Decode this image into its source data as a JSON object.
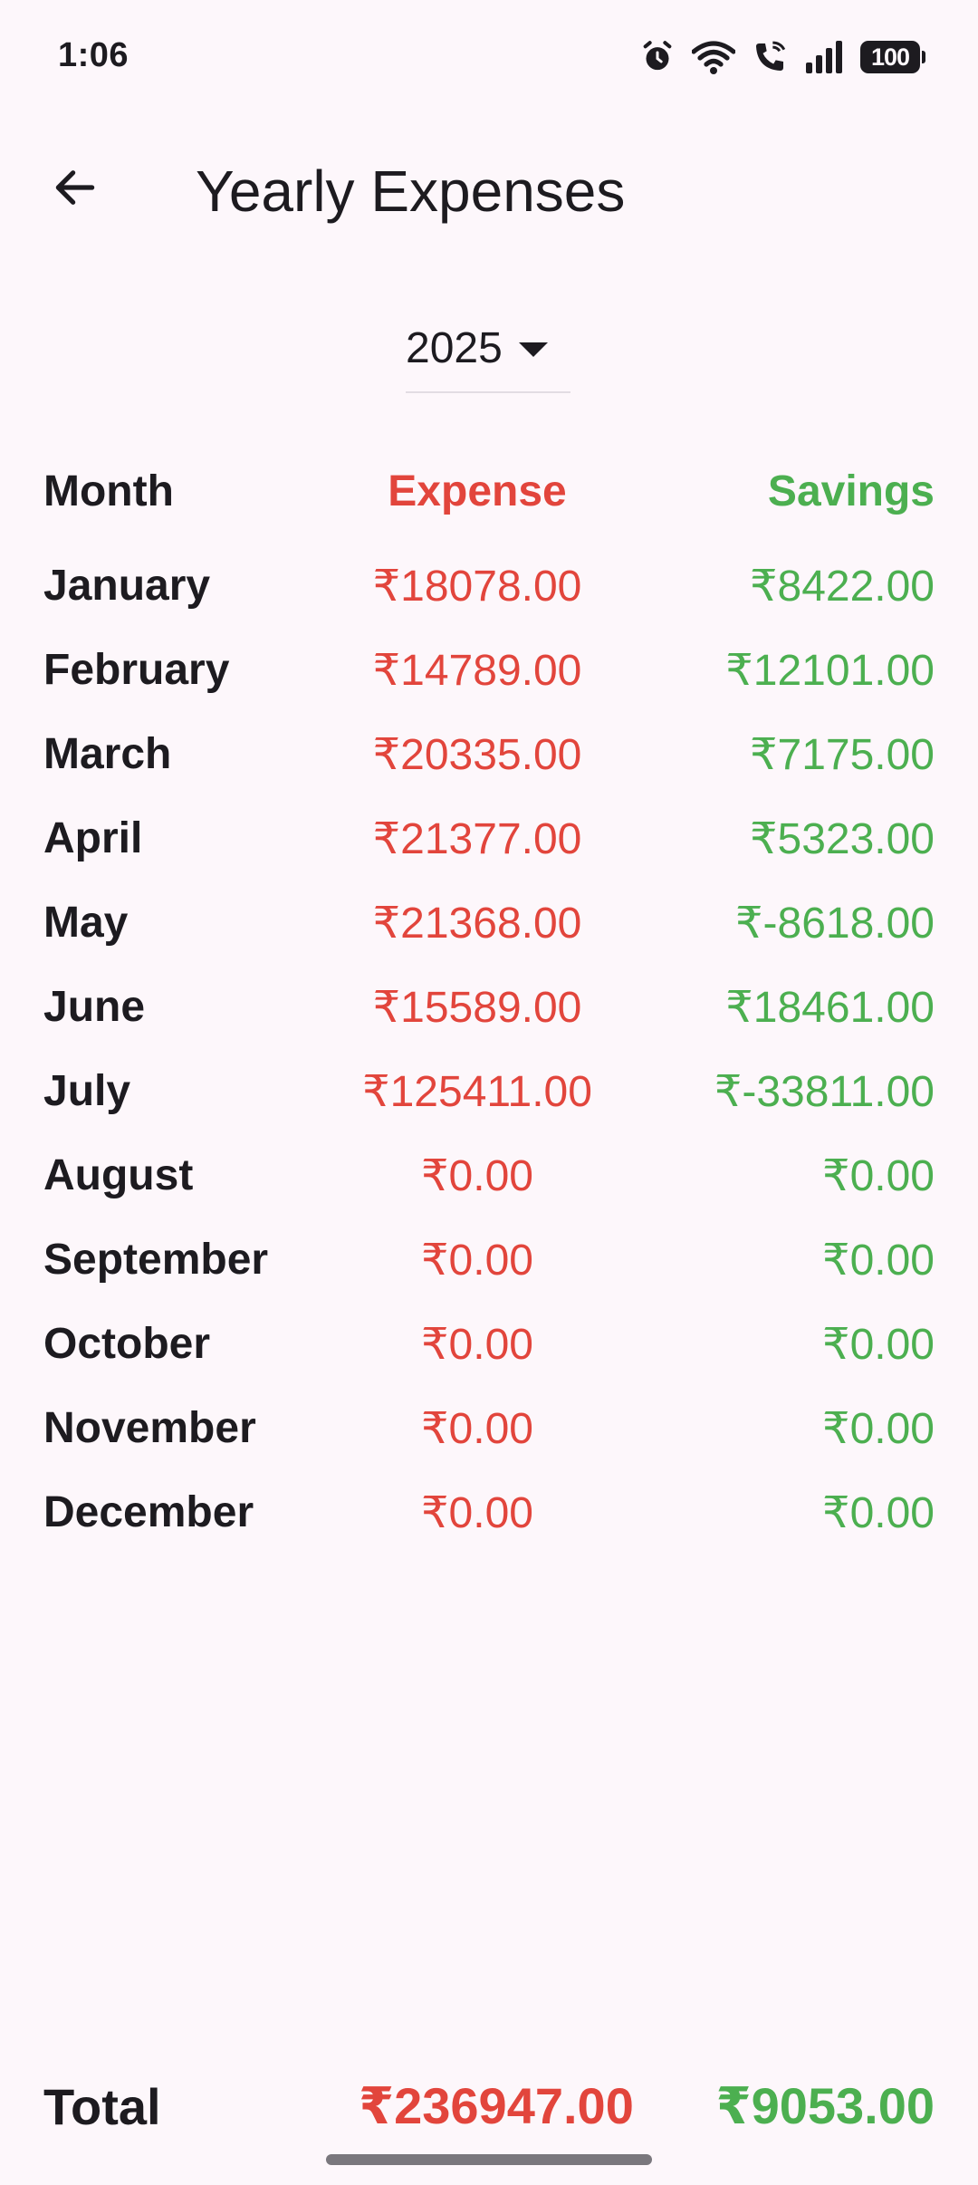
{
  "status_bar": {
    "time": "1:06",
    "battery": "100",
    "icons": [
      "alarm-icon",
      "wifi-icon",
      "wifi-calling-icon",
      "signal-icon",
      "battery-icon"
    ]
  },
  "app_bar": {
    "title": "Yearly Expenses",
    "back_icon": "arrow-back-icon"
  },
  "year_select": {
    "value": "2025"
  },
  "table": {
    "headers": {
      "month": "Month",
      "expense": "Expense",
      "savings": "Savings"
    },
    "rows": [
      {
        "month": "January",
        "expense": "₹18078.00",
        "savings": "₹8422.00"
      },
      {
        "month": "February",
        "expense": "₹14789.00",
        "savings": "₹12101.00"
      },
      {
        "month": "March",
        "expense": "₹20335.00",
        "savings": "₹7175.00"
      },
      {
        "month": "April",
        "expense": "₹21377.00",
        "savings": "₹5323.00"
      },
      {
        "month": "May",
        "expense": "₹21368.00",
        "savings": "₹-8618.00"
      },
      {
        "month": "June",
        "expense": "₹15589.00",
        "savings": "₹18461.00"
      },
      {
        "month": "July",
        "expense": "₹125411.00",
        "savings": "₹-33811.00"
      },
      {
        "month": "August",
        "expense": "₹0.00",
        "savings": "₹0.00"
      },
      {
        "month": "September",
        "expense": "₹0.00",
        "savings": "₹0.00"
      },
      {
        "month": "October",
        "expense": "₹0.00",
        "savings": "₹0.00"
      },
      {
        "month": "November",
        "expense": "₹0.00",
        "savings": "₹0.00"
      },
      {
        "month": "December",
        "expense": "₹0.00",
        "savings": "₹0.00"
      }
    ]
  },
  "total": {
    "label": "Total",
    "expense": "₹236947.00",
    "savings": "₹9053.00"
  },
  "colors": {
    "background": "#FDF7FB",
    "expense": "#E2453C",
    "savings": "#4CAF50",
    "text": "#1D1B20"
  }
}
